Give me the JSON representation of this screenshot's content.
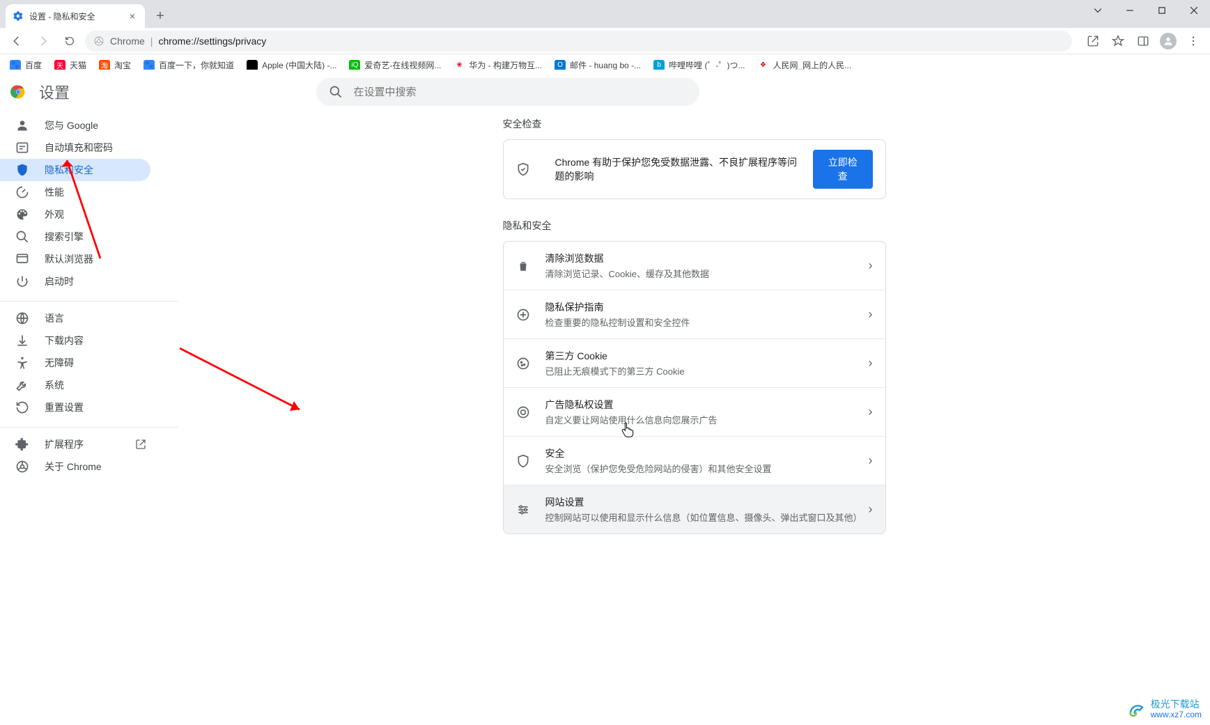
{
  "browser": {
    "tab_title": "设置 - 隐私和安全",
    "url_app": "Chrome",
    "url_path": "chrome://settings/privacy"
  },
  "bookmarks": [
    {
      "label": "百度",
      "color": "#3385ff"
    },
    {
      "label": "天猫",
      "color": "#ff0036"
    },
    {
      "label": "淘宝",
      "color": "#ff5000"
    },
    {
      "label": "百度一下，你就知道",
      "color": "#3385ff"
    },
    {
      "label": "Apple (中国大陆) -...",
      "color": "#000"
    },
    {
      "label": "爱奇艺-在线视频网...",
      "color": "#00be06"
    },
    {
      "label": "华为 - 构建万物互...",
      "color": "#cf0a2c"
    },
    {
      "label": "邮件 - huang bo -...",
      "color": "#0078d4"
    },
    {
      "label": "哔哩哔哩 (゜-゜)つ...",
      "color": "#00a1d6"
    },
    {
      "label": "人民网_网上的人民...",
      "color": "#cc0000"
    }
  ],
  "page_title": "设置",
  "search": {
    "placeholder": "在设置中搜索"
  },
  "sidebar": {
    "group1": [
      {
        "label": "您与 Google"
      },
      {
        "label": "自动填充和密码"
      },
      {
        "label": "隐私和安全"
      },
      {
        "label": "性能"
      },
      {
        "label": "外观"
      },
      {
        "label": "搜索引擎"
      },
      {
        "label": "默认浏览器"
      },
      {
        "label": "启动时"
      }
    ],
    "group2": [
      {
        "label": "语言"
      },
      {
        "label": "下载内容"
      },
      {
        "label": "无障碍"
      },
      {
        "label": "系统"
      },
      {
        "label": "重置设置"
      }
    ],
    "group3": [
      {
        "label": "扩展程序"
      },
      {
        "label": "关于 Chrome"
      }
    ]
  },
  "safety_check": {
    "heading": "安全检查",
    "text": "Chrome 有助于保护您免受数据泄露、不良扩展程序等问题的影响",
    "button": "立即检查"
  },
  "privacy_section": {
    "heading": "隐私和安全",
    "rows": [
      {
        "title": "清除浏览数据",
        "sub": "清除浏览记录、Cookie、缓存及其他数据"
      },
      {
        "title": "隐私保护指南",
        "sub": "检查重要的隐私控制设置和安全控件"
      },
      {
        "title": "第三方 Cookie",
        "sub": "已阻止无痕模式下的第三方 Cookie"
      },
      {
        "title": "广告隐私权设置",
        "sub": "自定义要让网站使用什么信息向您展示广告"
      },
      {
        "title": "安全",
        "sub": "安全浏览（保护您免受危险网站的侵害）和其他安全设置"
      },
      {
        "title": "网站设置",
        "sub": "控制网站可以使用和显示什么信息（如位置信息、摄像头、弹出式窗口及其他）"
      }
    ]
  },
  "watermark": {
    "name": "极光下载站",
    "url": "www.xz7.com"
  }
}
